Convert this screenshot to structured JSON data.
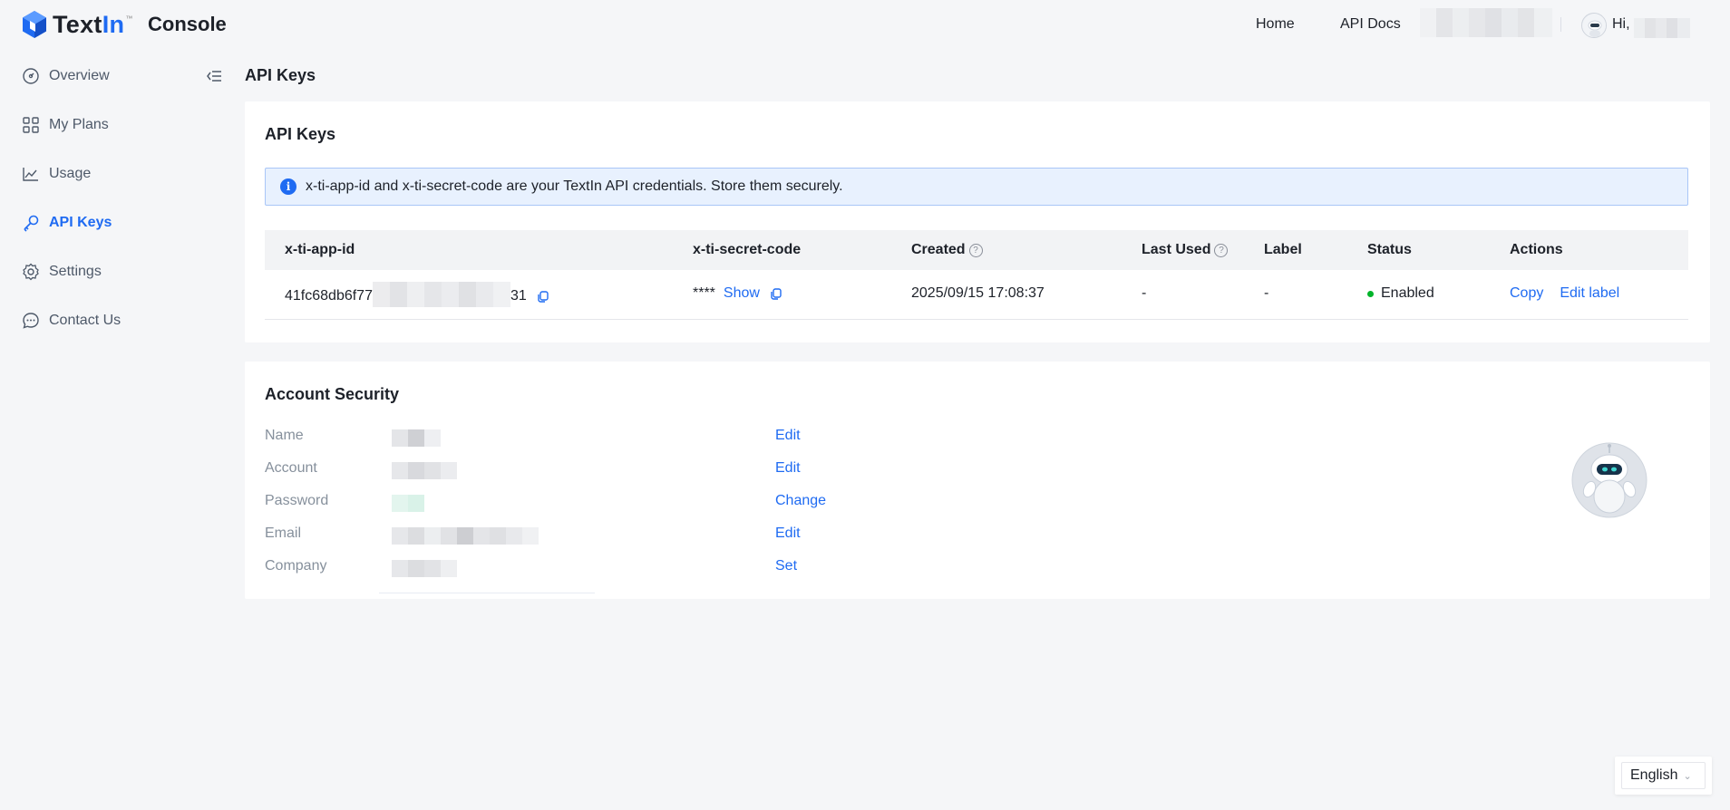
{
  "header": {
    "brand_text": "Text",
    "brand_in": "In",
    "brand_tm": "™",
    "console_title": "Console",
    "nav_home": "Home",
    "nav_docs": "API Docs",
    "greeting": "Hi,"
  },
  "sidebar": {
    "items": [
      {
        "label": "Overview",
        "icon": "gauge-icon"
      },
      {
        "label": "My Plans",
        "icon": "grid-icon"
      },
      {
        "label": "Usage",
        "icon": "chart-icon"
      },
      {
        "label": "API Keys",
        "icon": "key-icon",
        "active": true
      },
      {
        "label": "Settings",
        "icon": "gear-icon"
      },
      {
        "label": "Contact Us",
        "icon": "chat-icon"
      }
    ]
  },
  "page_title": "API Keys",
  "api_keys_card": {
    "title": "API Keys",
    "alert_text": "x-ti-app-id and x-ti-secret-code are your TextIn API credentials. Store them securely.",
    "columns": {
      "app_id": "x-ti-app-id",
      "secret": "x-ti-secret-code",
      "created": "Created",
      "last_used": "Last Used",
      "label": "Label",
      "status": "Status",
      "actions": "Actions"
    },
    "row": {
      "app_id_prefix": "41fc68db6f77",
      "app_id_suffix": "31",
      "secret_masked": "****",
      "show_label": "Show",
      "created": "2025/09/15 17:08:37",
      "last_used": "-",
      "label": "-",
      "status": "Enabled",
      "copy_label": "Copy",
      "edit_label": "Edit label"
    },
    "status_color": "#00b42a"
  },
  "security_card": {
    "title": "Account Security",
    "rows": [
      {
        "label": "Name",
        "action": "Edit"
      },
      {
        "label": "Account",
        "action": "Edit"
      },
      {
        "label": "Password",
        "action": "Change"
      },
      {
        "label": "Email",
        "action": "Edit"
      },
      {
        "label": "Company",
        "action": "Set"
      }
    ]
  },
  "language": {
    "selected": "English"
  },
  "colors": {
    "accent": "#1f6bf2",
    "background": "#f5f6f8",
    "alert_bg": "#e8f1fe"
  }
}
